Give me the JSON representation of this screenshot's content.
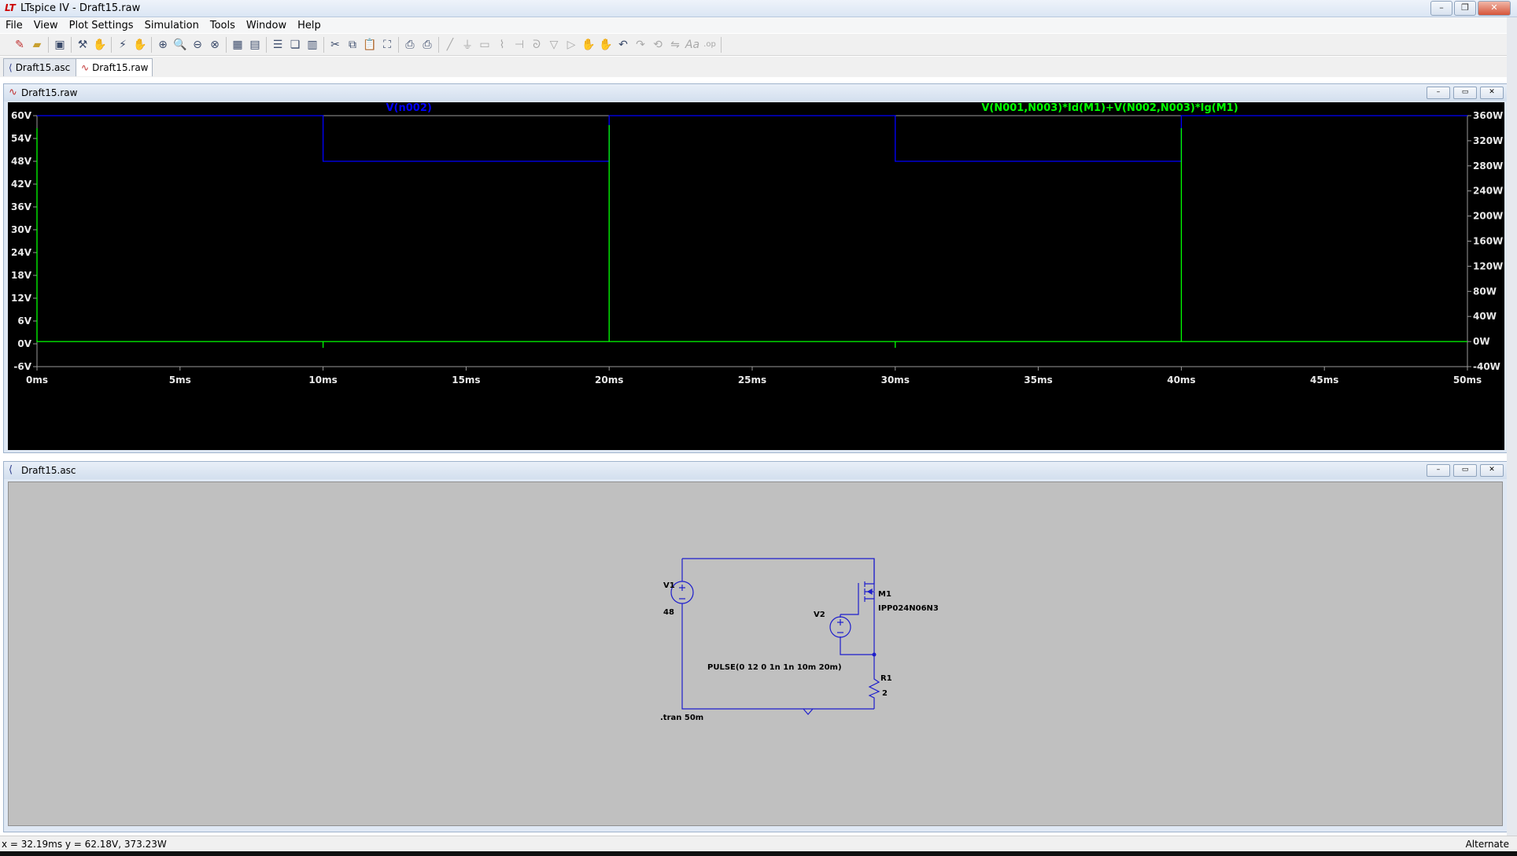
{
  "window": {
    "title": "LTspice IV - Draft15.raw",
    "app_icon": "LT"
  },
  "menu": [
    "File",
    "View",
    "Plot Settings",
    "Simulation",
    "Tools",
    "Window",
    "Help"
  ],
  "tabs": [
    {
      "label": "Draft15.asc"
    },
    {
      "label": "Draft15.raw"
    }
  ],
  "plot_window": {
    "title": "Draft15.raw",
    "trace_labels": [
      "V(n002)",
      "V(N001,N003)*Id(M1)+V(N002,N003)*Ig(M1)"
    ],
    "colors": {
      "bg": "#000000",
      "grid_text": "#e8e8e8",
      "trace1": "#0000ff",
      "trace2": "#00ff00"
    }
  },
  "chart_data": {
    "type": "line",
    "xlabel": "",
    "ylabel": "",
    "x_ticks": [
      "0ms",
      "5ms",
      "10ms",
      "15ms",
      "20ms",
      "25ms",
      "30ms",
      "35ms",
      "40ms",
      "45ms",
      "50ms"
    ],
    "y_left_ticks": [
      "60V",
      "54V",
      "48V",
      "42V",
      "36V",
      "30V",
      "24V",
      "18V",
      "12V",
      "6V",
      "0V",
      "-6V"
    ],
    "y_right_ticks": [
      "360W",
      "320W",
      "280W",
      "240W",
      "200W",
      "160W",
      "120W",
      "80W",
      "40W",
      "0W",
      "-40W"
    ],
    "xlim": [
      0,
      50
    ],
    "ylim_left": [
      -6,
      60
    ],
    "ylim_right": [
      -40,
      360
    ],
    "series": [
      {
        "name": "V(n002)",
        "axis": "left",
        "x": [
          0,
          10,
          10,
          20,
          20,
          30,
          30,
          40,
          40,
          50
        ],
        "y": [
          60,
          60,
          48,
          48,
          60,
          60,
          48,
          48,
          60,
          60
        ]
      },
      {
        "name": "V(N001,N003)*Id(M1)+V(N002,N003)*Ig(M1)",
        "axis": "right",
        "x": [
          0,
          0,
          0,
          10,
          10,
          10,
          20,
          20,
          20,
          30,
          30,
          30,
          40,
          40,
          40,
          50
        ],
        "y": [
          340,
          0,
          0,
          0,
          -10,
          0,
          0,
          345,
          0,
          0,
          -10,
          0,
          0,
          340,
          0,
          0
        ]
      }
    ]
  },
  "schematic_window": {
    "title": "Draft15.asc",
    "labels": {
      "v1_name": "V1",
      "v1_value": "48",
      "v2_name": "V2",
      "v2_value": "PULSE(0 12 0 1n 1n 10m 20m)",
      "m1_name": "M1",
      "m1_model": "IPP024N06N3",
      "r1_name": "R1",
      "r1_value": "2",
      "directive": ".tran 50m"
    }
  },
  "status": {
    "coords": "x = 32.19ms    y = 62.18V, 373.23W",
    "mode": "Alternate"
  }
}
